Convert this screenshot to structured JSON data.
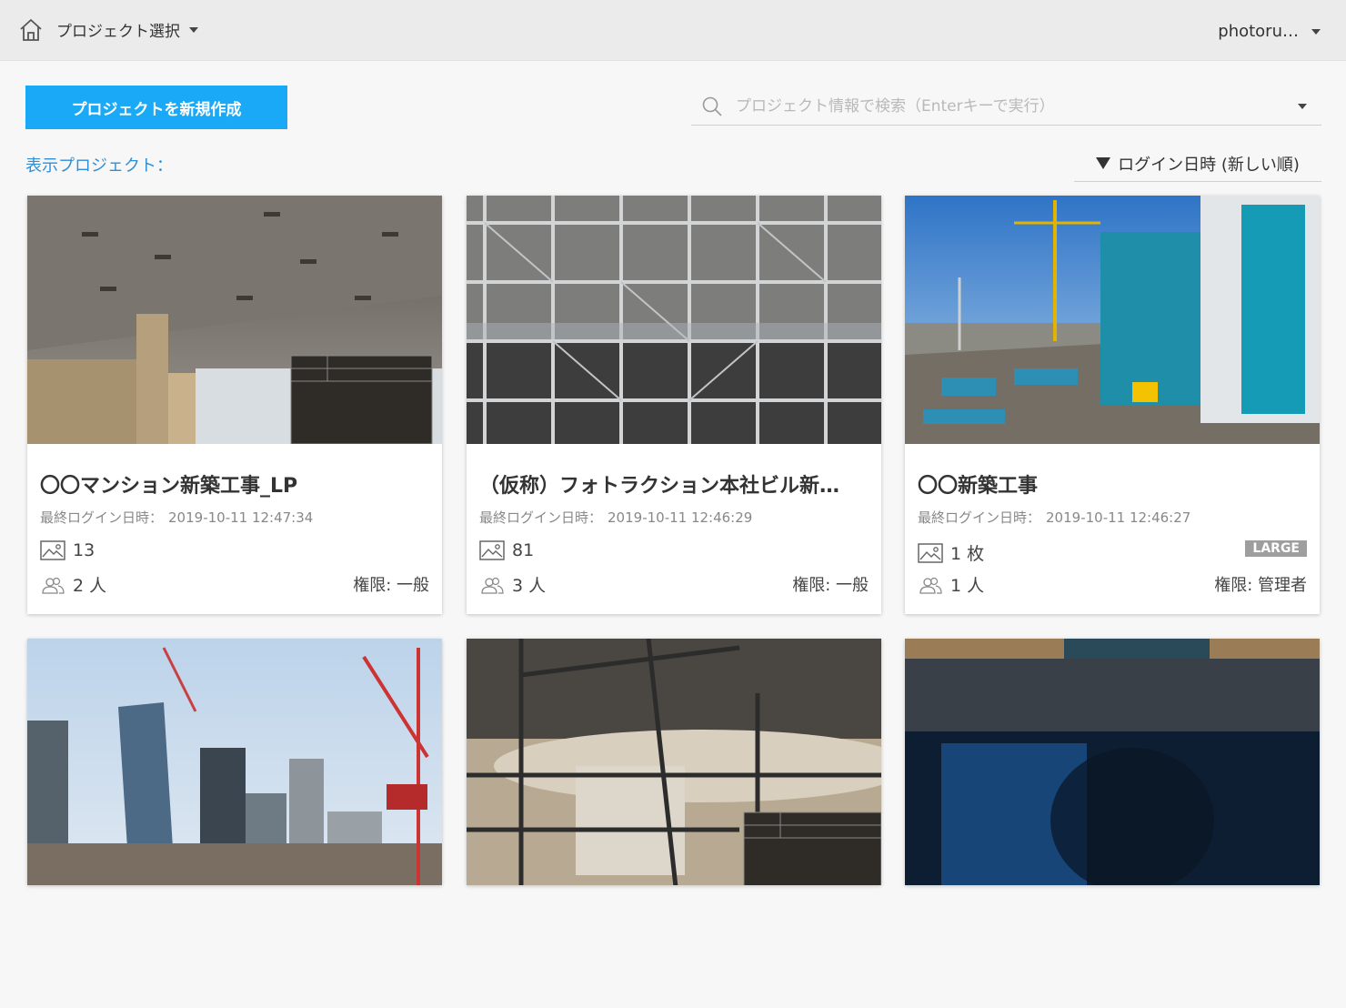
{
  "header": {
    "project_select": "プロジェクト選択",
    "user": "photoru…"
  },
  "toolbar": {
    "new_project": "プロジェクトを新規作成",
    "search_placeholder": "プロジェクト情報で検索（Enterキーで実行）",
    "display_label": "表示プロジェクト：",
    "sort_label": "ログイン日時 (新しい順)"
  },
  "cards": [
    {
      "title": "〇〇マンション新築工事_LP",
      "last_login_label": "最終ログイン日時：",
      "last_login": "2019-10-11 12:47:34",
      "photos": "13",
      "members": "2 人",
      "permission": "権限: 一般",
      "thumb": "interior-ceiling"
    },
    {
      "title": "（仮称）フォトラクション本社ビル新…",
      "last_login_label": "最終ログイン日時：",
      "last_login": "2019-10-11 12:46:29",
      "photos": "81",
      "members": "3 人",
      "permission": "権限: 一般",
      "thumb": "scaffolding"
    },
    {
      "title": "〇〇新築工事",
      "last_login_label": "最終ログイン日時：",
      "last_login": "2019-10-11 12:46:27",
      "photos": "1 枚",
      "members": "1 人",
      "permission": "権限: 管理者",
      "badge": "LARGE",
      "thumb": "construction-site"
    },
    {
      "thumb": "city-skyline-cranes"
    },
    {
      "thumb": "interior-scaffold"
    },
    {
      "thumb": "tablet-dark"
    }
  ],
  "colors": {
    "accent": "#1aa9f7",
    "link": "#2f8fd6",
    "badge": "#9e9e9e"
  }
}
